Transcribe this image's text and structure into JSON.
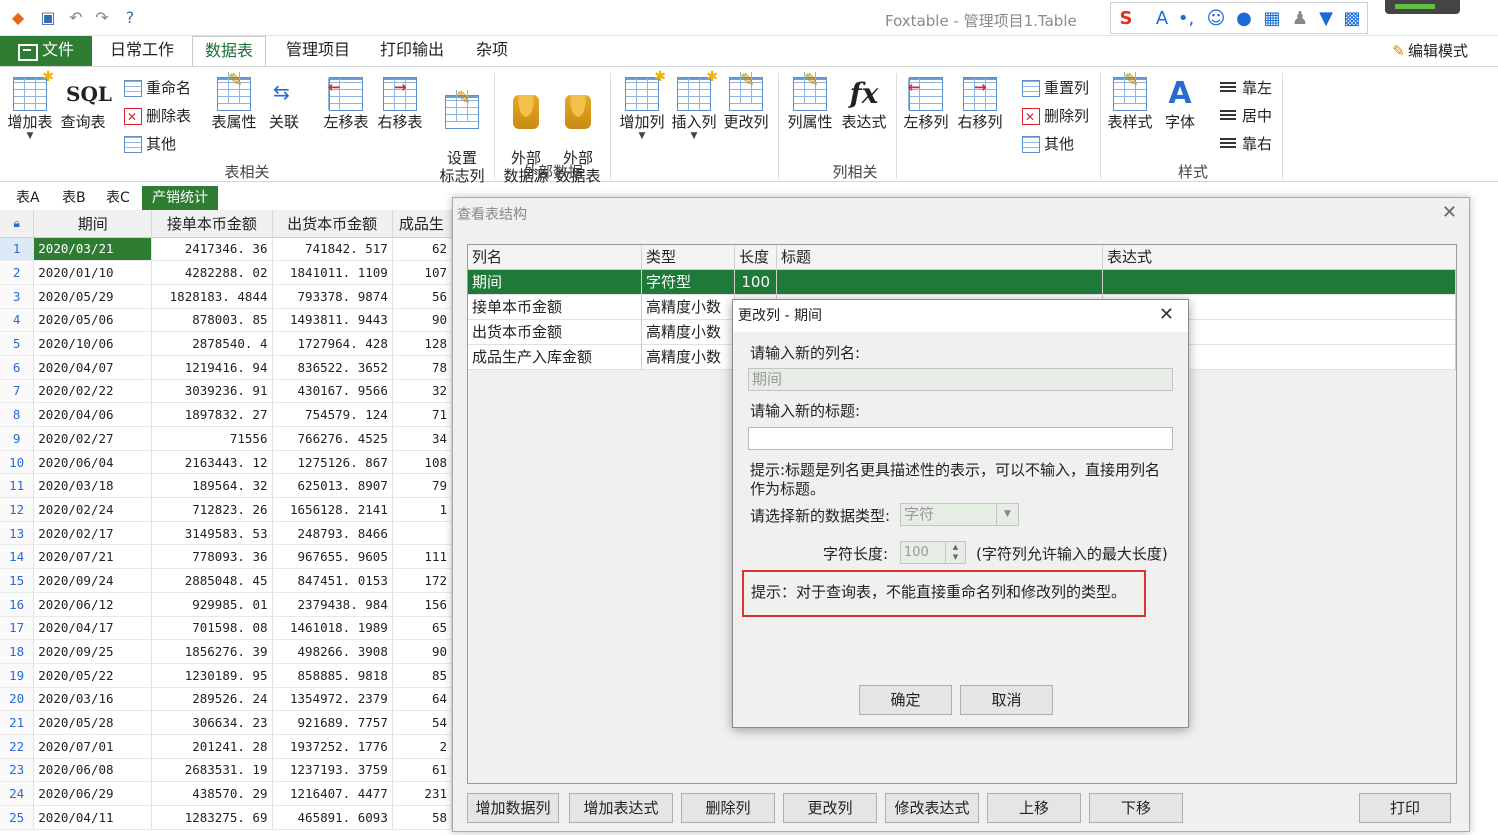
{
  "app": {
    "title": "Foxtable - 管理项目1.Table"
  },
  "ribbon_tabs": [
    "文件",
    "日常工作",
    "数据表",
    "管理项目",
    "打印输出",
    "杂项"
  ],
  "edit_mode": "编辑模式",
  "ribbon": {
    "add_table": "增加表",
    "query_table": "查询表",
    "sql": "SQL",
    "rename": "重命名",
    "delete_table": "删除表",
    "other1": "其他",
    "table_props": "表属性",
    "relation": "关联",
    "move_left": "左移表",
    "move_right": "右移表",
    "set_flag_col": "设置\n标志列",
    "ext_source": "外部\n数据源",
    "ext_table": "外部\n数据表",
    "add_col": "增加列",
    "insert_col": "插入列",
    "change_col": "更改列",
    "col_props": "列属性",
    "expression": "表达式",
    "col_left": "左移列",
    "col_right": "右移列",
    "reset_col": "重置列",
    "delete_col": "删除列",
    "other2": "其他",
    "table_style": "表样式",
    "font": "字体",
    "align_left": "靠左",
    "align_center": "居中",
    "align_right": "靠右",
    "group_table": "表相关",
    "group_external": "外部数据",
    "group_column": "列相关",
    "group_style": "样式"
  },
  "sheet_tabs": [
    "表A",
    "表B",
    "表C",
    "产销统计"
  ],
  "grid": {
    "headers": [
      "期间",
      "接单本币金额",
      "出货本币金额",
      "成品生"
    ],
    "rows": [
      [
        "1",
        "2020/03/21",
        "2417346. 36",
        "741842. 517",
        "62"
      ],
      [
        "2",
        "2020/01/10",
        "4282288. 02",
        "1841011. 1109",
        "107"
      ],
      [
        "3",
        "2020/05/29",
        "1828183. 4844",
        "793378. 9874",
        "56"
      ],
      [
        "4",
        "2020/05/06",
        "878003. 85",
        "1493811. 9443",
        "90"
      ],
      [
        "5",
        "2020/10/06",
        "2878540. 4",
        "1727964. 428",
        "128"
      ],
      [
        "6",
        "2020/04/07",
        "1219416. 94",
        "836522. 3652",
        "78"
      ],
      [
        "7",
        "2020/02/22",
        "3039236. 91",
        "430167. 9566",
        "32"
      ],
      [
        "8",
        "2020/04/06",
        "1897832. 27",
        "754579. 124",
        "71"
      ],
      [
        "9",
        "2020/02/27",
        "71556",
        "766276. 4525",
        "34"
      ],
      [
        "10",
        "2020/06/04",
        "2163443. 12",
        "1275126. 867",
        "108"
      ],
      [
        "11",
        "2020/03/18",
        "189564. 32",
        "625013. 8907",
        "79"
      ],
      [
        "12",
        "2020/02/24",
        "712823. 26",
        "1656128. 2141",
        "1"
      ],
      [
        "13",
        "2020/02/17",
        "3149583. 53",
        "248793. 8466",
        ""
      ],
      [
        "14",
        "2020/07/21",
        "778093. 36",
        "967655. 9605",
        "111"
      ],
      [
        "15",
        "2020/09/24",
        "2885048. 45",
        "847451. 0153",
        "172"
      ],
      [
        "16",
        "2020/06/12",
        "929985. 01",
        "2379438. 984",
        "156"
      ],
      [
        "17",
        "2020/04/17",
        "701598. 08",
        "1461018. 1989",
        "65"
      ],
      [
        "18",
        "2020/09/25",
        "1856276. 39",
        "498266. 3908",
        "90"
      ],
      [
        "19",
        "2020/05/22",
        "1230189. 95",
        "858885. 9818",
        "85"
      ],
      [
        "20",
        "2020/03/16",
        "289526. 24",
        "1354972. 2379",
        "64"
      ],
      [
        "21",
        "2020/05/28",
        "306634. 23",
        "921689. 7757",
        "54"
      ],
      [
        "22",
        "2020/07/01",
        "201241. 28",
        "1937252. 1776",
        "2"
      ],
      [
        "23",
        "2020/06/08",
        "2683531. 19",
        "1237193. 3759",
        "61"
      ],
      [
        "24",
        "2020/06/29",
        "438570. 29",
        "1216407. 4477",
        "231"
      ],
      [
        "25",
        "2020/04/11",
        "1283275. 69",
        "465891. 6093",
        "58"
      ]
    ]
  },
  "struct": {
    "title": "查看表结构",
    "headers": [
      "列名",
      "类型",
      "长度",
      "标题",
      "表达式"
    ],
    "rows": [
      [
        "期间",
        "字符型",
        "100",
        "",
        ""
      ],
      [
        "接单本币金额",
        "高精度小数",
        "",
        "",
        ""
      ],
      [
        "出货本币金额",
        "高精度小数",
        "",
        "",
        ""
      ],
      [
        "成品生产入库金额",
        "高精度小数",
        "",
        "",
        ""
      ]
    ],
    "buttons": [
      "增加数据列",
      "增加表达式",
      "删除列",
      "更改列",
      "修改表达式",
      "上移",
      "下移",
      "打印"
    ]
  },
  "dialog": {
    "title": "更改列 - 期间",
    "name_label": "请输入新的列名:",
    "name_value": "期间",
    "caption_label": "请输入新的标题:",
    "caption_value": "",
    "caption_hint": "提示:标题是列名更具描述性的表示，可以不输入，直接用列名作为标题。",
    "type_label": "请选择新的数据类型:",
    "type_value": "字符",
    "length_label": "字符长度:",
    "length_value": "100",
    "length_hint": "(字符列允许输入的最大长度)",
    "warning": "提示：对于查询表，不能直接重命名列和修改列的类型。",
    "ok": "确定",
    "cancel": "取消"
  },
  "colors": {
    "accent": "#2e7d32",
    "warning_border": "#e03030"
  }
}
